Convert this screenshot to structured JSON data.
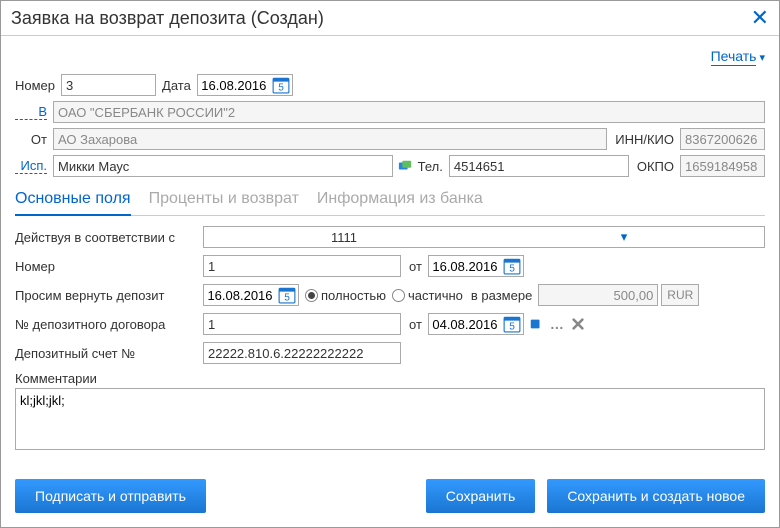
{
  "title": "Заявка на возврат депозита (Создан)",
  "print": "Печать",
  "header": {
    "number_lbl": "Номер",
    "number": "3",
    "date_lbl": "Дата",
    "date": "16.08.2016",
    "to_lbl": "В",
    "to": "ОАО \"СБЕРБАНК РОССИИ\"2",
    "from_lbl": "От",
    "from": "АО Захарова",
    "inn_lbl": "ИНН/КИО",
    "inn": "8367200626",
    "isp_lbl": "Исп.",
    "isp": "Микки Маус",
    "tel_lbl": "Тел.",
    "tel": "4514651",
    "okpo_lbl": "ОКПО",
    "okpo": "1659184958"
  },
  "tabs": {
    "t1": "Основные поля",
    "t2": "Проценты и возврат",
    "t3": "Информация из банка"
  },
  "body": {
    "acting_lbl": "Действуя в соответствии с",
    "acting": "1111",
    "number_lbl": "Номер",
    "number": "1",
    "ot_lbl": "от",
    "number_date": "16.08.2016",
    "request_lbl": "Просим вернуть депозит",
    "request_date": "16.08.2016",
    "full_lbl": "полностью",
    "part_lbl": "частично",
    "size_lbl": "в размере",
    "size_val": "500,00",
    "cur": "RUR",
    "contract_lbl": "№ депозитного договора",
    "contract": "1",
    "contract_date": "04.08.2016",
    "account_lbl": "Депозитный счет №",
    "account": "22222.810.6.22222222222",
    "comments_lbl": "Комментарии",
    "comments": "kl;jkl;jkl;"
  },
  "buttons": {
    "sign": "Подписать и отправить",
    "save": "Сохранить",
    "save_new": "Сохранить и создать новое"
  }
}
